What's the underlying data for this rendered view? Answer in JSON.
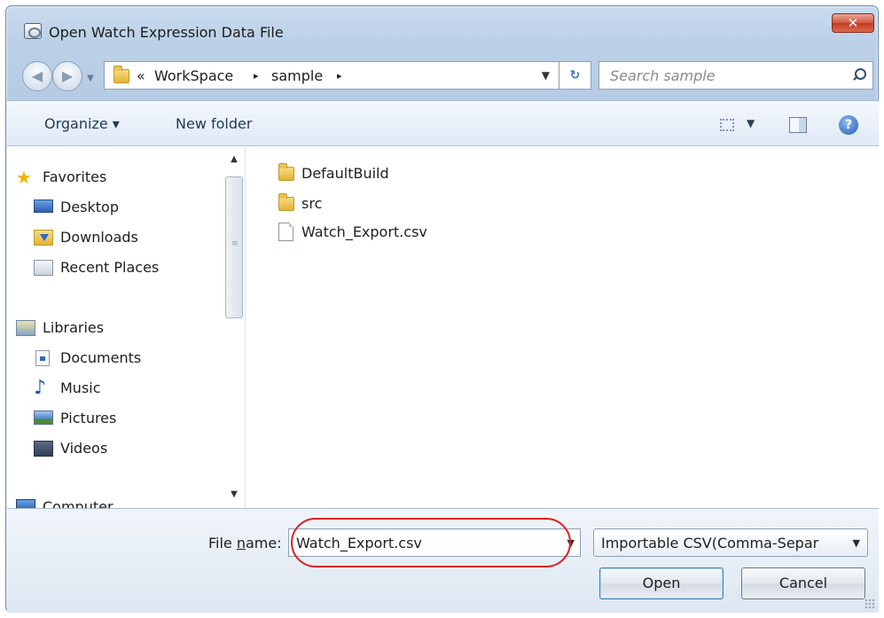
{
  "window": {
    "title": "Open Watch Expression Data File",
    "close_label": "✕"
  },
  "nav": {
    "breadcrumb": [
      "«",
      "WorkSpace",
      "▸",
      "sample",
      "▸"
    ],
    "search_placeholder": "Search sample"
  },
  "toolbar": {
    "organize_label": "Organize ▾",
    "new_folder_label": "New folder"
  },
  "sidebar": {
    "items": [
      {
        "label": "Favorites",
        "icon": "star-icon"
      },
      {
        "label": "Desktop",
        "icon": "desktop-icon"
      },
      {
        "label": "Downloads",
        "icon": "downloads-icon"
      },
      {
        "label": "Recent Places",
        "icon": "recent-places-icon"
      },
      {
        "label": "Libraries",
        "icon": "libraries-icon"
      },
      {
        "label": "Documents",
        "icon": "documents-icon"
      },
      {
        "label": "Music",
        "icon": "music-icon"
      },
      {
        "label": "Pictures",
        "icon": "pictures-icon"
      },
      {
        "label": "Videos",
        "icon": "videos-icon"
      },
      {
        "label": "Computer",
        "icon": "computer-icon"
      }
    ]
  },
  "files": [
    {
      "name": "DefaultBuild",
      "type": "folder"
    },
    {
      "name": "src",
      "type": "folder"
    },
    {
      "name": "Watch_Export.csv",
      "type": "file"
    }
  ],
  "footer": {
    "filename_label_pre": "File ",
    "filename_label_u": "n",
    "filename_label_post": "ame:",
    "filename_value": "Watch_Export.csv",
    "filetype_value": "Importable CSV(Comma-Separ",
    "open_label": "Open",
    "cancel_label": "Cancel"
  },
  "colors": {
    "highlight": "#e01e1e",
    "window_frame": "#bcd1e8"
  }
}
